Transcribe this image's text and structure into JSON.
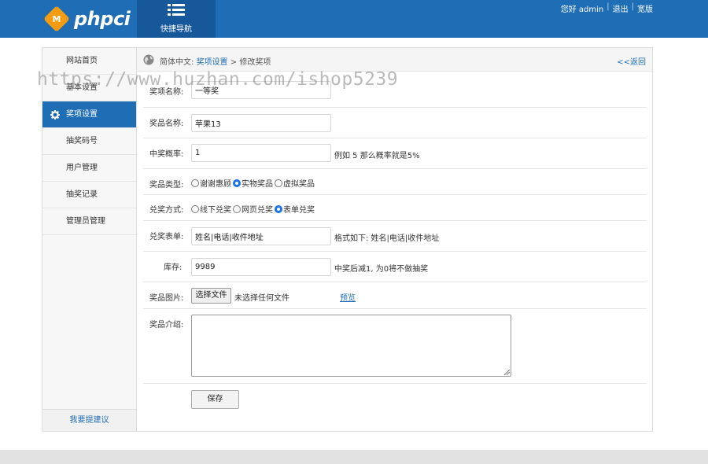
{
  "header": {
    "logo_badge": "M",
    "logo_text": "phpci",
    "quick_nav_label": "快捷导航",
    "greeting": "您好 admin",
    "logout": "退出",
    "clear": "宽版"
  },
  "sidebar": {
    "items": [
      {
        "label": "网站首页"
      },
      {
        "label": "基本设置"
      },
      {
        "label": "奖项设置",
        "active": true,
        "icon": "gear-icon"
      },
      {
        "label": "抽奖码号"
      },
      {
        "label": "用户管理"
      },
      {
        "label": "抽奖记录"
      },
      {
        "label": "管理员管理"
      }
    ],
    "bottom_link": "我要提建议"
  },
  "breadcrumb": {
    "prefix": "简体中文:",
    "link": "奖项设置",
    "separator": ">",
    "current": "修改奖项",
    "back": "<<返回"
  },
  "form": {
    "prize_name": {
      "label": "奖项名称:",
      "value": "一等奖"
    },
    "goods_name": {
      "label": "奖品名称:",
      "value": "苹果13"
    },
    "probability": {
      "label": "中奖概率:",
      "value": "1",
      "hint": "例如 5 那么概率就是5%"
    },
    "prize_type": {
      "label": "奖品类型:",
      "options": [
        "谢谢惠顾",
        "实物奖品",
        "虚拟奖品"
      ],
      "selected": "实物奖品"
    },
    "redeem_method": {
      "label": "兑奖方式:",
      "options": [
        "线下兑奖",
        "网页兑奖",
        "表单兑奖"
      ],
      "selected": "表单兑奖"
    },
    "redeem_form": {
      "label": "兑奖表单:",
      "value": "姓名|电话|收件地址",
      "hint": "格式如下: 姓名|电话|收件地址"
    },
    "stock": {
      "label": "库存:",
      "value": "9989",
      "hint": "中奖后减1, 为0将不做抽奖"
    },
    "image": {
      "label": "奖品图片:",
      "button": "选择文件",
      "status": "未选择任何文件",
      "preview": "预览"
    },
    "intro": {
      "label": "奖品介绍:",
      "value": ""
    },
    "save_label": "保存"
  },
  "watermark": "https://www.huzhan.com/ishop5239",
  "colors": {
    "primary": "#1e6db5",
    "primary_dark": "#17589a",
    "accent": "#f39c12"
  }
}
